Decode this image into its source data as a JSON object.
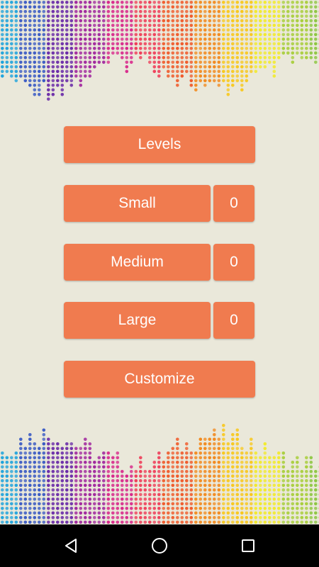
{
  "menu": {
    "levels_label": "Levels",
    "modes": [
      {
        "label": "Small",
        "count": "0"
      },
      {
        "label": "Medium",
        "count": "0"
      },
      {
        "label": "Large",
        "count": "0"
      }
    ],
    "customize_label": "Customize"
  },
  "colors": {
    "background": "#EAE8DA",
    "button": "#F07B4F",
    "button_text": "#FFFFFF",
    "navbar": "#000000",
    "spectrum": [
      "#1FA3DC",
      "#3B5BC4",
      "#6A2BA8",
      "#A1289E",
      "#D8268A",
      "#EF3F5A",
      "#F05A2A",
      "#F28A1E",
      "#F8C81C",
      "#F2EA2A",
      "#A8CE3A",
      "#8CC63F"
    ]
  },
  "navigation": {
    "back_icon": "back-triangle-icon",
    "home_icon": "home-circle-icon",
    "recents_icon": "recents-square-icon"
  }
}
